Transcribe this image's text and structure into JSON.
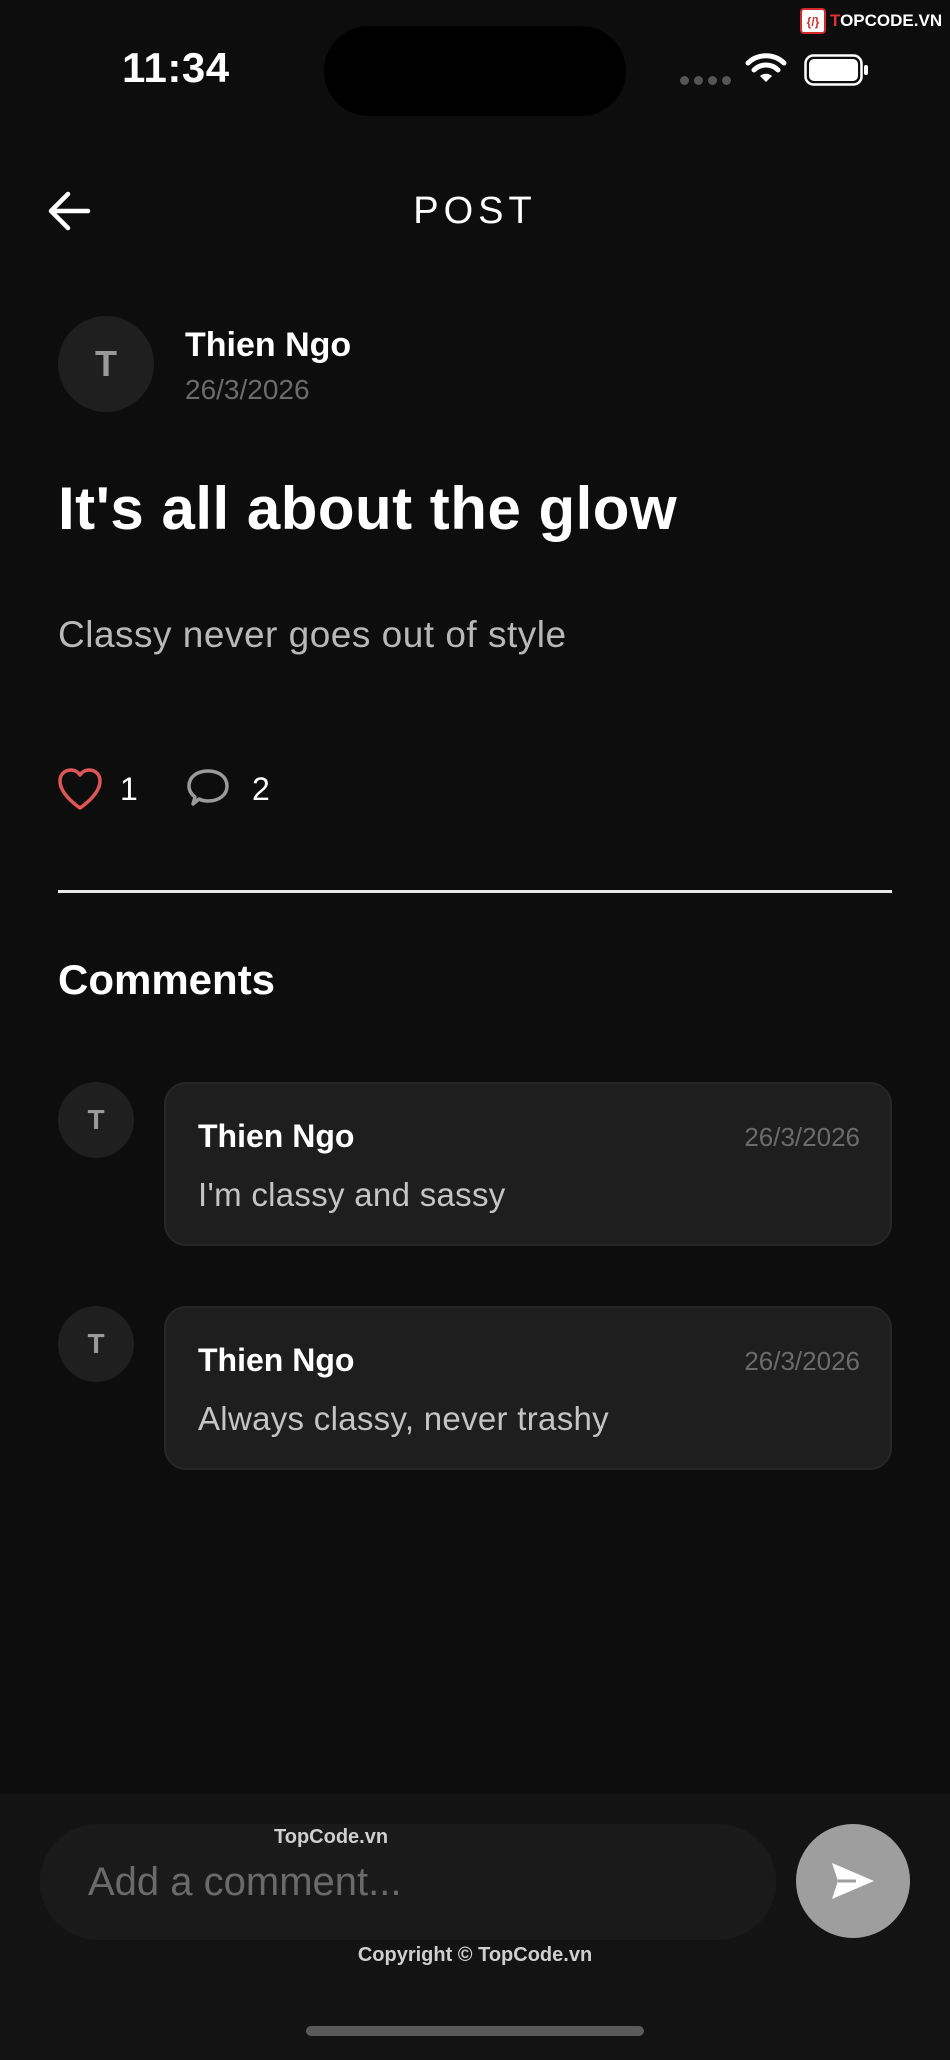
{
  "status_bar": {
    "time": "11:34"
  },
  "watermark": {
    "logo_mark": "{/}",
    "logo_text_red": "T",
    "logo_text_rest": "OPCODE.VN",
    "label_top": "TopCode.vn",
    "copyright": "Copyright © TopCode.vn"
  },
  "header": {
    "back_icon": "arrow-left-icon",
    "title": "POST"
  },
  "post": {
    "author": {
      "initial": "T",
      "name": "Thien Ngo",
      "date": "26/3/2026"
    },
    "title": "It's all about the glow",
    "body": "Classy never goes out of style",
    "likes": "1",
    "comments_count": "2",
    "colors": {
      "like_icon": "#e05555",
      "comment_icon": "#9a9a9a"
    }
  },
  "comments_section": {
    "heading": "Comments",
    "items": [
      {
        "initial": "T",
        "author": "Thien Ngo",
        "date": "26/3/2026",
        "text": "I'm classy and sassy"
      },
      {
        "initial": "T",
        "author": "Thien Ngo",
        "date": "26/3/2026",
        "text": "Always classy, never trashy"
      }
    ]
  },
  "composer": {
    "placeholder": "Add a comment...",
    "send_icon": "send-icon"
  }
}
